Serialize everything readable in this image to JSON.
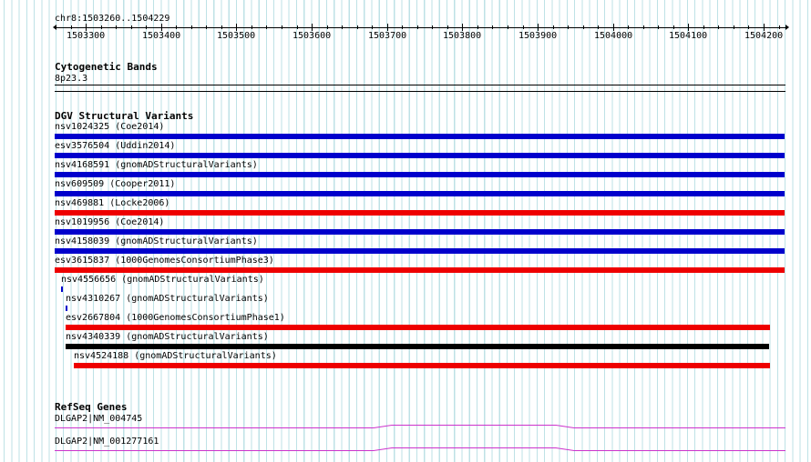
{
  "ruler": {
    "region_label": "chr8:1503260..1504229",
    "tick_labels": [
      "1503300",
      "1503400",
      "1503500",
      "1503600",
      "1503700",
      "1503800",
      "1503900",
      "1504000",
      "1504100",
      "1504200"
    ]
  },
  "tracks": {
    "cytoband": {
      "title": "Cytogenetic Bands",
      "band_label": "8p23.3"
    },
    "dgv": {
      "title": "DGV Structural Variants",
      "features": [
        {
          "label": "nsv1024325 (Coe2014)",
          "color": "#0000cc",
          "start": 1503260,
          "end": 1504229
        },
        {
          "label": "esv3576504 (Uddin2014)",
          "color": "#0000cc",
          "start": 1503260,
          "end": 1504229
        },
        {
          "label": "nsv4168591 (gnomADStructuralVariants)",
          "color": "#0000cc",
          "start": 1503260,
          "end": 1504229
        },
        {
          "label": "nsv609509 (Cooper2011)",
          "color": "#0000cc",
          "start": 1503260,
          "end": 1504229
        },
        {
          "label": "nsv469881 (Locke2006)",
          "color": "#ee0000",
          "start": 1503260,
          "end": 1504229
        },
        {
          "label": "nsv1019956 (Coe2014)",
          "color": "#0000cc",
          "start": 1503260,
          "end": 1504229
        },
        {
          "label": "nsv4158039 (gnomADStructuralVariants)",
          "color": "#0000cc",
          "start": 1503260,
          "end": 1504229
        },
        {
          "label": "esv3615837 (1000GenomesConsortiumPhase3)",
          "color": "#ee0000",
          "start": 1503260,
          "end": 1504229
        },
        {
          "label": "nsv4556656 (gnomADStructuralVariants)",
          "color": "#0000cc",
          "start": 1503268,
          "end": 1503270
        },
        {
          "label": "nsv4310267 (gnomADStructuralVariants)",
          "color": "#0000cc",
          "start": 1503274,
          "end": 1503276
        },
        {
          "label": "esv2667804 (1000GenomesConsortiumPhase1)",
          "color": "#ee0000",
          "start": 1503274,
          "end": 1504209
        },
        {
          "label": "nsv4340339 (gnomADStructuralVariants)",
          "color": "#000000",
          "start": 1503275,
          "end": 1504209
        },
        {
          "label": "nsv4524188 (gnomADStructuralVariants)",
          "color": "#ee0000",
          "start": 1503285,
          "end": 1504209
        }
      ]
    },
    "refseq": {
      "title": "RefSeq Genes",
      "genes": [
        {
          "label": "DLGAP2|NM_004745",
          "color": "#cc33cc"
        },
        {
          "label": "DLGAP2|NM_001277161",
          "color": "#cc33cc"
        }
      ]
    }
  }
}
